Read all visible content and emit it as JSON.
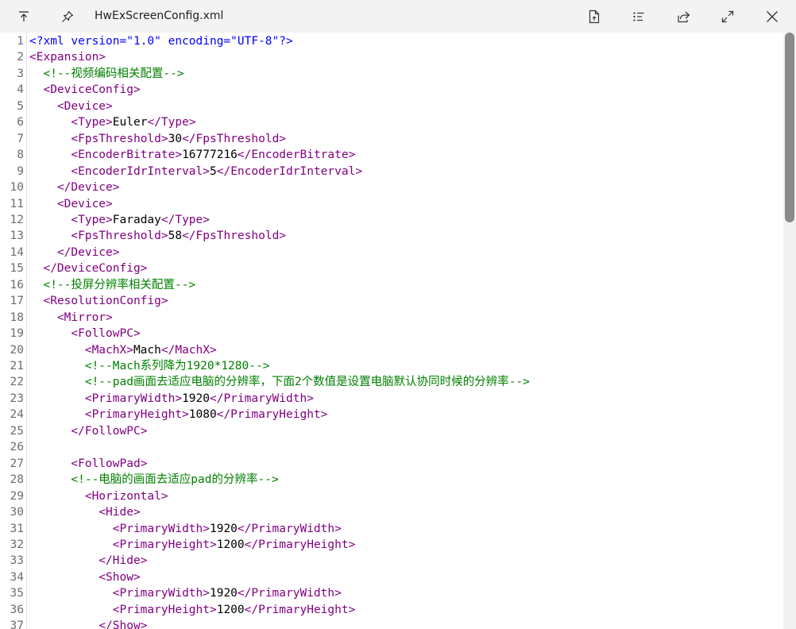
{
  "window": {
    "title": "HwExScreenConfig.xml"
  },
  "toolbar": {
    "icons": [
      "pin-top-icon",
      "pin-icon",
      "new-file-icon",
      "list-icon",
      "share-icon",
      "expand-icon",
      "close-icon"
    ]
  },
  "editor": {
    "lines": [
      {
        "n": "1",
        "segs": [
          [
            "b",
            "<?xml version=\"1.0\" encoding=\"UTF-8\"?>"
          ]
        ]
      },
      {
        "n": "2",
        "segs": [
          [
            "t",
            "<Expansion>"
          ]
        ]
      },
      {
        "n": "3",
        "segs": [
          [
            "x",
            "  "
          ],
          [
            "c",
            "<!--视频编码相关配置-->"
          ]
        ]
      },
      {
        "n": "4",
        "segs": [
          [
            "x",
            "  "
          ],
          [
            "t",
            "<DeviceConfig>"
          ]
        ]
      },
      {
        "n": "5",
        "segs": [
          [
            "x",
            "    "
          ],
          [
            "t",
            "<Device>"
          ]
        ]
      },
      {
        "n": "6",
        "segs": [
          [
            "x",
            "      "
          ],
          [
            "t",
            "<Type>"
          ],
          [
            "x",
            "Euler"
          ],
          [
            "t",
            "</Type>"
          ]
        ]
      },
      {
        "n": "7",
        "segs": [
          [
            "x",
            "      "
          ],
          [
            "t",
            "<FpsThreshold>"
          ],
          [
            "x",
            "30"
          ],
          [
            "t",
            "</FpsThreshold>"
          ]
        ]
      },
      {
        "n": "8",
        "segs": [
          [
            "x",
            "      "
          ],
          [
            "t",
            "<EncoderBitrate>"
          ],
          [
            "x",
            "16777216"
          ],
          [
            "t",
            "</EncoderBitrate>"
          ]
        ]
      },
      {
        "n": "9",
        "segs": [
          [
            "x",
            "      "
          ],
          [
            "t",
            "<EncoderIdrInterval>"
          ],
          [
            "x",
            "5"
          ],
          [
            "t",
            "</EncoderIdrInterval>"
          ]
        ]
      },
      {
        "n": "10",
        "segs": [
          [
            "x",
            "    "
          ],
          [
            "t",
            "</Device>"
          ]
        ]
      },
      {
        "n": "11",
        "segs": [
          [
            "x",
            "    "
          ],
          [
            "t",
            "<Device>"
          ]
        ]
      },
      {
        "n": "12",
        "segs": [
          [
            "x",
            "      "
          ],
          [
            "t",
            "<Type>"
          ],
          [
            "x",
            "Faraday"
          ],
          [
            "t",
            "</Type>"
          ]
        ]
      },
      {
        "n": "13",
        "segs": [
          [
            "x",
            "      "
          ],
          [
            "t",
            "<FpsThreshold>"
          ],
          [
            "x",
            "58"
          ],
          [
            "t",
            "</FpsThreshold>"
          ]
        ]
      },
      {
        "n": "14",
        "segs": [
          [
            "x",
            "    "
          ],
          [
            "t",
            "</Device>"
          ]
        ]
      },
      {
        "n": "15",
        "segs": [
          [
            "x",
            "  "
          ],
          [
            "t",
            "</DeviceConfig>"
          ]
        ]
      },
      {
        "n": "16",
        "segs": [
          [
            "x",
            "  "
          ],
          [
            "c",
            "<!--投屏分辨率相关配置-->"
          ]
        ]
      },
      {
        "n": "17",
        "segs": [
          [
            "x",
            "  "
          ],
          [
            "t",
            "<ResolutionConfig>"
          ]
        ]
      },
      {
        "n": "18",
        "segs": [
          [
            "x",
            "    "
          ],
          [
            "t",
            "<Mirror>"
          ]
        ]
      },
      {
        "n": "19",
        "segs": [
          [
            "x",
            "      "
          ],
          [
            "t",
            "<FollowPC>"
          ]
        ]
      },
      {
        "n": "20",
        "segs": [
          [
            "x",
            "        "
          ],
          [
            "t",
            "<MachX>"
          ],
          [
            "x",
            "Mach"
          ],
          [
            "t",
            "</MachX>"
          ]
        ]
      },
      {
        "n": "21",
        "segs": [
          [
            "x",
            "        "
          ],
          [
            "c",
            "<!--Mach系列降为1920*1280-->"
          ]
        ]
      },
      {
        "n": "22",
        "segs": [
          [
            "x",
            "        "
          ],
          [
            "c",
            "<!--pad画面去适应电脑的分辨率，下面2个数值是设置电脑默认协同时候的分辨率-->"
          ]
        ]
      },
      {
        "n": "23",
        "segs": [
          [
            "x",
            "        "
          ],
          [
            "t",
            "<PrimaryWidth>"
          ],
          [
            "x",
            "1920"
          ],
          [
            "t",
            "</PrimaryWidth>"
          ]
        ]
      },
      {
        "n": "24",
        "segs": [
          [
            "x",
            "        "
          ],
          [
            "t",
            "<PrimaryHeight>"
          ],
          [
            "x",
            "1080"
          ],
          [
            "t",
            "</PrimaryHeight>"
          ]
        ]
      },
      {
        "n": "25",
        "segs": [
          [
            "x",
            "      "
          ],
          [
            "t",
            "</FollowPC>"
          ]
        ]
      },
      {
        "n": "26",
        "segs": []
      },
      {
        "n": "27",
        "segs": [
          [
            "x",
            "      "
          ],
          [
            "t",
            "<FollowPad>"
          ]
        ]
      },
      {
        "n": "28",
        "segs": [
          [
            "x",
            "      "
          ],
          [
            "c",
            "<!--电脑的画面去适应pad的分辨率-->"
          ]
        ]
      },
      {
        "n": "29",
        "segs": [
          [
            "x",
            "        "
          ],
          [
            "t",
            "<Horizontal>"
          ]
        ]
      },
      {
        "n": "30",
        "segs": [
          [
            "x",
            "          "
          ],
          [
            "t",
            "<Hide>"
          ]
        ]
      },
      {
        "n": "31",
        "segs": [
          [
            "x",
            "            "
          ],
          [
            "t",
            "<PrimaryWidth>"
          ],
          [
            "x",
            "1920"
          ],
          [
            "t",
            "</PrimaryWidth>"
          ]
        ]
      },
      {
        "n": "32",
        "segs": [
          [
            "x",
            "            "
          ],
          [
            "t",
            "<PrimaryHeight>"
          ],
          [
            "x",
            "1200"
          ],
          [
            "t",
            "</PrimaryHeight>"
          ]
        ]
      },
      {
        "n": "33",
        "segs": [
          [
            "x",
            "          "
          ],
          [
            "t",
            "</Hide>"
          ]
        ]
      },
      {
        "n": "34",
        "segs": [
          [
            "x",
            "          "
          ],
          [
            "t",
            "<Show>"
          ]
        ]
      },
      {
        "n": "35",
        "segs": [
          [
            "x",
            "            "
          ],
          [
            "t",
            "<PrimaryWidth>"
          ],
          [
            "x",
            "1920"
          ],
          [
            "t",
            "</PrimaryWidth>"
          ]
        ]
      },
      {
        "n": "36",
        "segs": [
          [
            "x",
            "            "
          ],
          [
            "t",
            "<PrimaryHeight>"
          ],
          [
            "x",
            "1200"
          ],
          [
            "t",
            "</PrimaryHeight>"
          ]
        ]
      },
      {
        "n": "37",
        "segs": [
          [
            "x",
            "          "
          ],
          [
            "t",
            "</Show>"
          ]
        ]
      }
    ]
  },
  "colors": {
    "tag": "#800080",
    "declaration": "#0000ff",
    "comment": "#008000",
    "text": "#000000",
    "line_number": "#6d6d6d"
  }
}
